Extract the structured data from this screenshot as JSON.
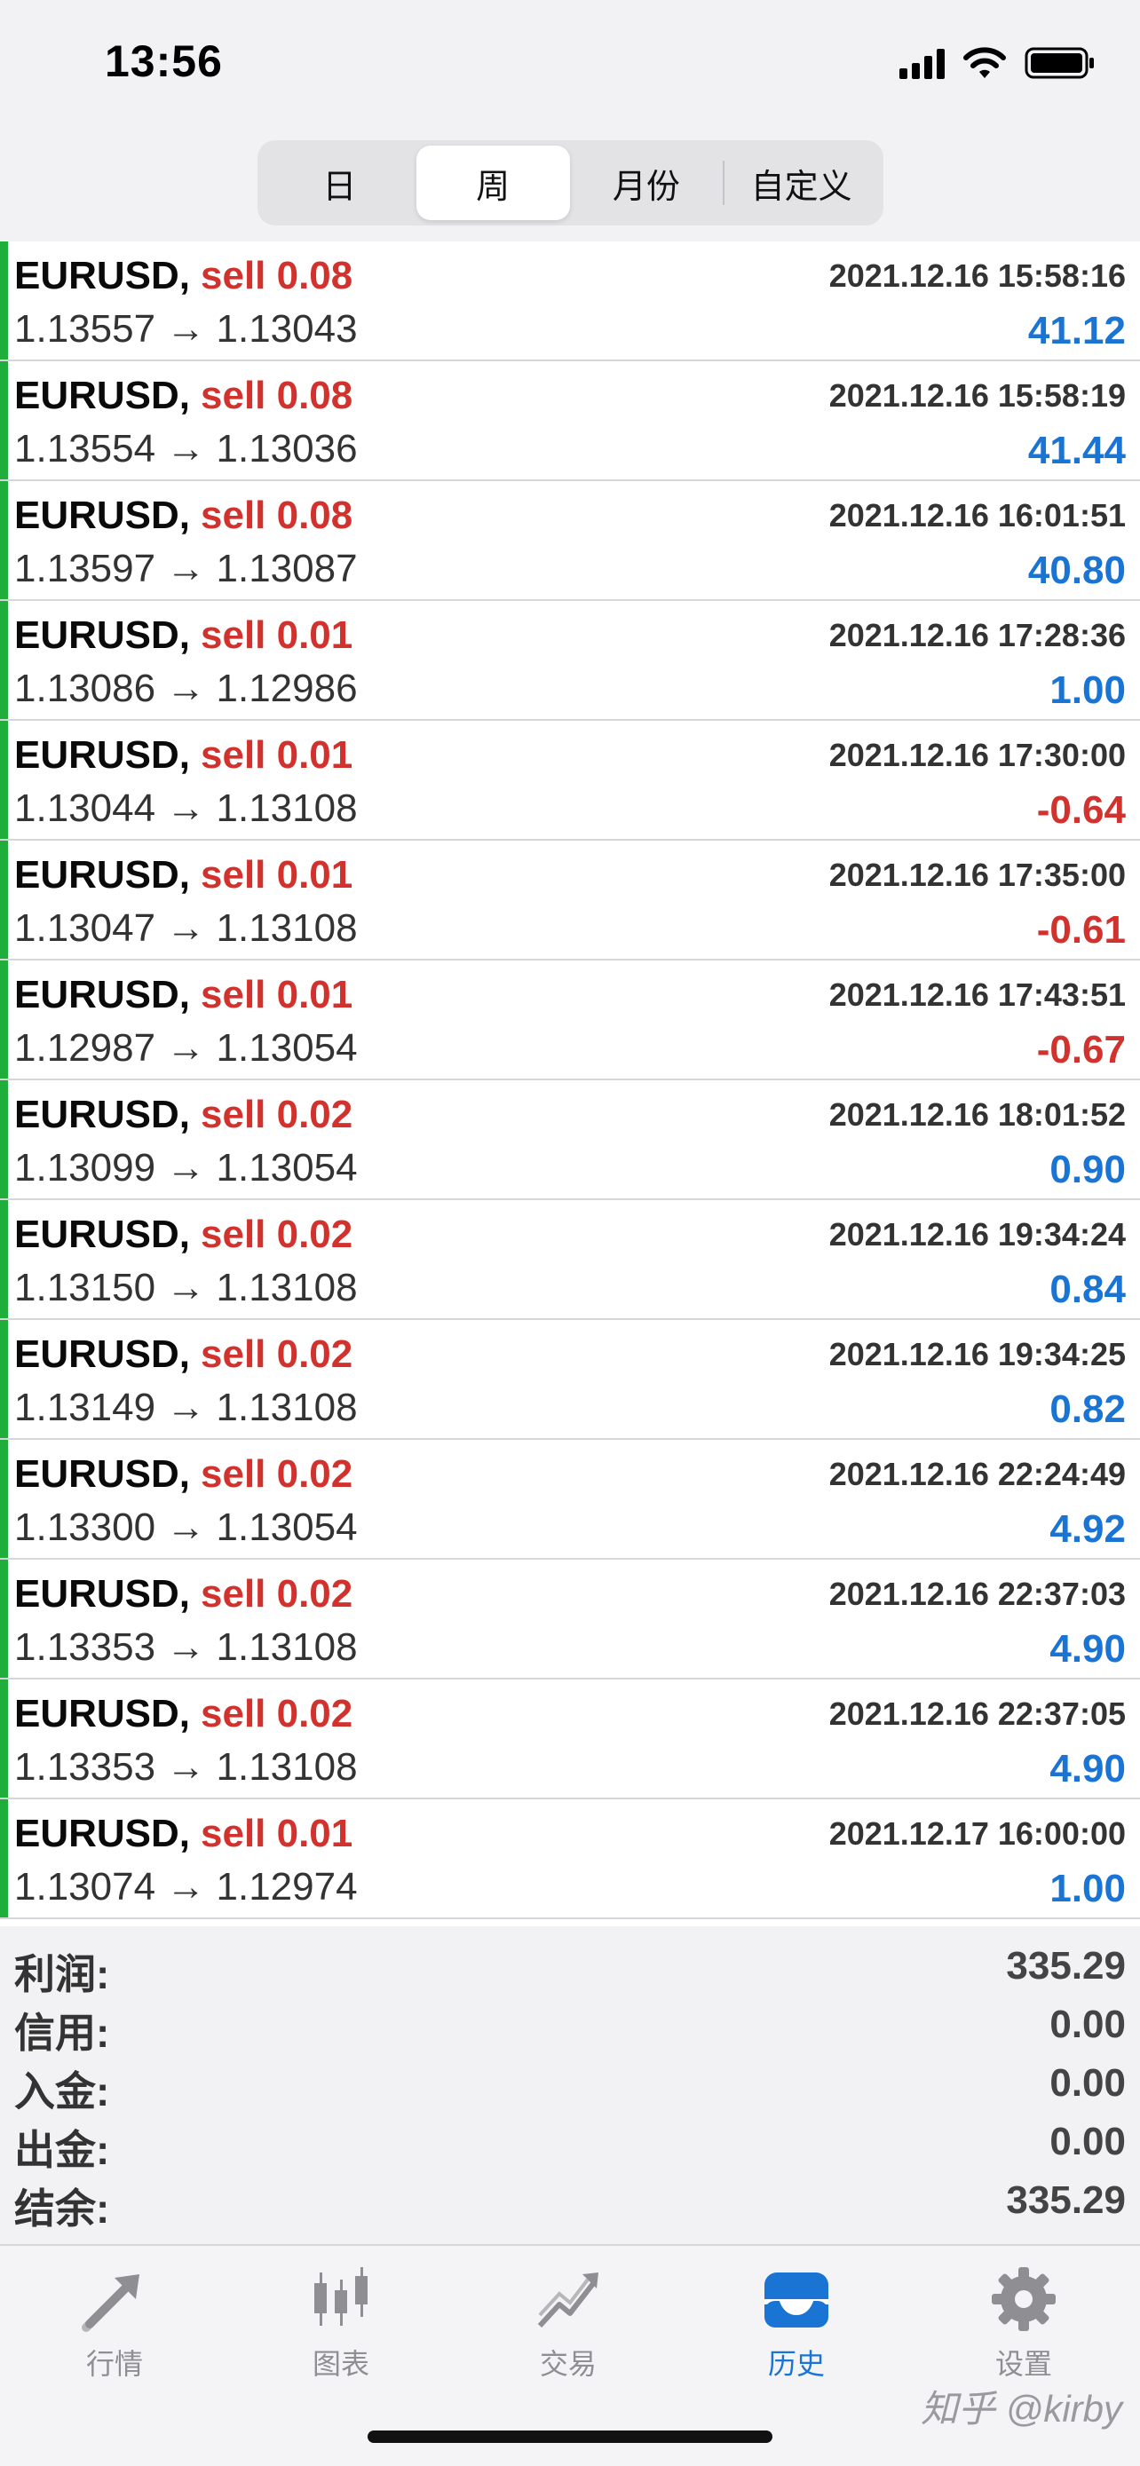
{
  "status_bar": {
    "time": "13:56"
  },
  "period_tabs": {
    "items": [
      {
        "label": "日"
      },
      {
        "label": "周",
        "active": true
      },
      {
        "label": "月份"
      },
      {
        "label": "自定义"
      }
    ]
  },
  "deals": [
    {
      "symbol": "EURUSD,",
      "type": "sell 0.08",
      "time": "2021.12.16 15:58:16",
      "prices": "1.13557 → 1.13043",
      "profit": "41.12",
      "profit_sign": "positive"
    },
    {
      "symbol": "EURUSD,",
      "type": "sell 0.08",
      "time": "2021.12.16 15:58:19",
      "prices": "1.13554 → 1.13036",
      "profit": "41.44",
      "profit_sign": "positive"
    },
    {
      "symbol": "EURUSD,",
      "type": "sell 0.08",
      "time": "2021.12.16 16:01:51",
      "prices": "1.13597 → 1.13087",
      "profit": "40.80",
      "profit_sign": "positive"
    },
    {
      "symbol": "EURUSD,",
      "type": "sell 0.01",
      "time": "2021.12.16 17:28:36",
      "prices": "1.13086 → 1.12986",
      "profit": "1.00",
      "profit_sign": "positive"
    },
    {
      "symbol": "EURUSD,",
      "type": "sell 0.01",
      "time": "2021.12.16 17:30:00",
      "prices": "1.13044 → 1.13108",
      "profit": "-0.64",
      "profit_sign": "negative"
    },
    {
      "symbol": "EURUSD,",
      "type": "sell 0.01",
      "time": "2021.12.16 17:35:00",
      "prices": "1.13047 → 1.13108",
      "profit": "-0.61",
      "profit_sign": "negative"
    },
    {
      "symbol": "EURUSD,",
      "type": "sell 0.01",
      "time": "2021.12.16 17:43:51",
      "prices": "1.12987 → 1.13054",
      "profit": "-0.67",
      "profit_sign": "negative"
    },
    {
      "symbol": "EURUSD,",
      "type": "sell 0.02",
      "time": "2021.12.16 18:01:52",
      "prices": "1.13099 → 1.13054",
      "profit": "0.90",
      "profit_sign": "positive"
    },
    {
      "symbol": "EURUSD,",
      "type": "sell 0.02",
      "time": "2021.12.16 19:34:24",
      "prices": "1.13150 → 1.13108",
      "profit": "0.84",
      "profit_sign": "positive"
    },
    {
      "symbol": "EURUSD,",
      "type": "sell 0.02",
      "time": "2021.12.16 19:34:25",
      "prices": "1.13149 → 1.13108",
      "profit": "0.82",
      "profit_sign": "positive"
    },
    {
      "symbol": "EURUSD,",
      "type": "sell 0.02",
      "time": "2021.12.16 22:24:49",
      "prices": "1.13300 → 1.13054",
      "profit": "4.92",
      "profit_sign": "positive"
    },
    {
      "symbol": "EURUSD,",
      "type": "sell 0.02",
      "time": "2021.12.16 22:37:03",
      "prices": "1.13353 → 1.13108",
      "profit": "4.90",
      "profit_sign": "positive"
    },
    {
      "symbol": "EURUSD,",
      "type": "sell 0.02",
      "time": "2021.12.16 22:37:05",
      "prices": "1.13353 → 1.13108",
      "profit": "4.90",
      "profit_sign": "positive"
    },
    {
      "symbol": "EURUSD,",
      "type": "sell 0.01",
      "time": "2021.12.17 16:00:00",
      "prices": "1.13074 → 1.12974",
      "profit": "1.00",
      "profit_sign": "positive"
    }
  ],
  "summary": [
    {
      "label": "利润:",
      "value": "335.29"
    },
    {
      "label": "信用:",
      "value": "0.00"
    },
    {
      "label": "入金:",
      "value": "0.00"
    },
    {
      "label": "出金:",
      "value": "0.00"
    },
    {
      "label": "结余:",
      "value": "335.29"
    }
  ],
  "tab_bar": {
    "items": [
      {
        "label": "行情",
        "icon": "quotes-arrows-icon"
      },
      {
        "label": "图表",
        "icon": "candlestick-chart-icon"
      },
      {
        "label": "交易",
        "icon": "trade-trend-icon"
      },
      {
        "label": "历史",
        "icon": "history-inbox-icon",
        "active": true
      },
      {
        "label": "设置",
        "icon": "gear-icon"
      }
    ]
  },
  "watermark": "知乎 @kirby",
  "colors": {
    "sell": "#d2322d",
    "profit_positive": "#1a74d4",
    "profit_negative": "#d2322d",
    "row_marker": "#1fae3c",
    "active_tab": "#1a74d4"
  }
}
